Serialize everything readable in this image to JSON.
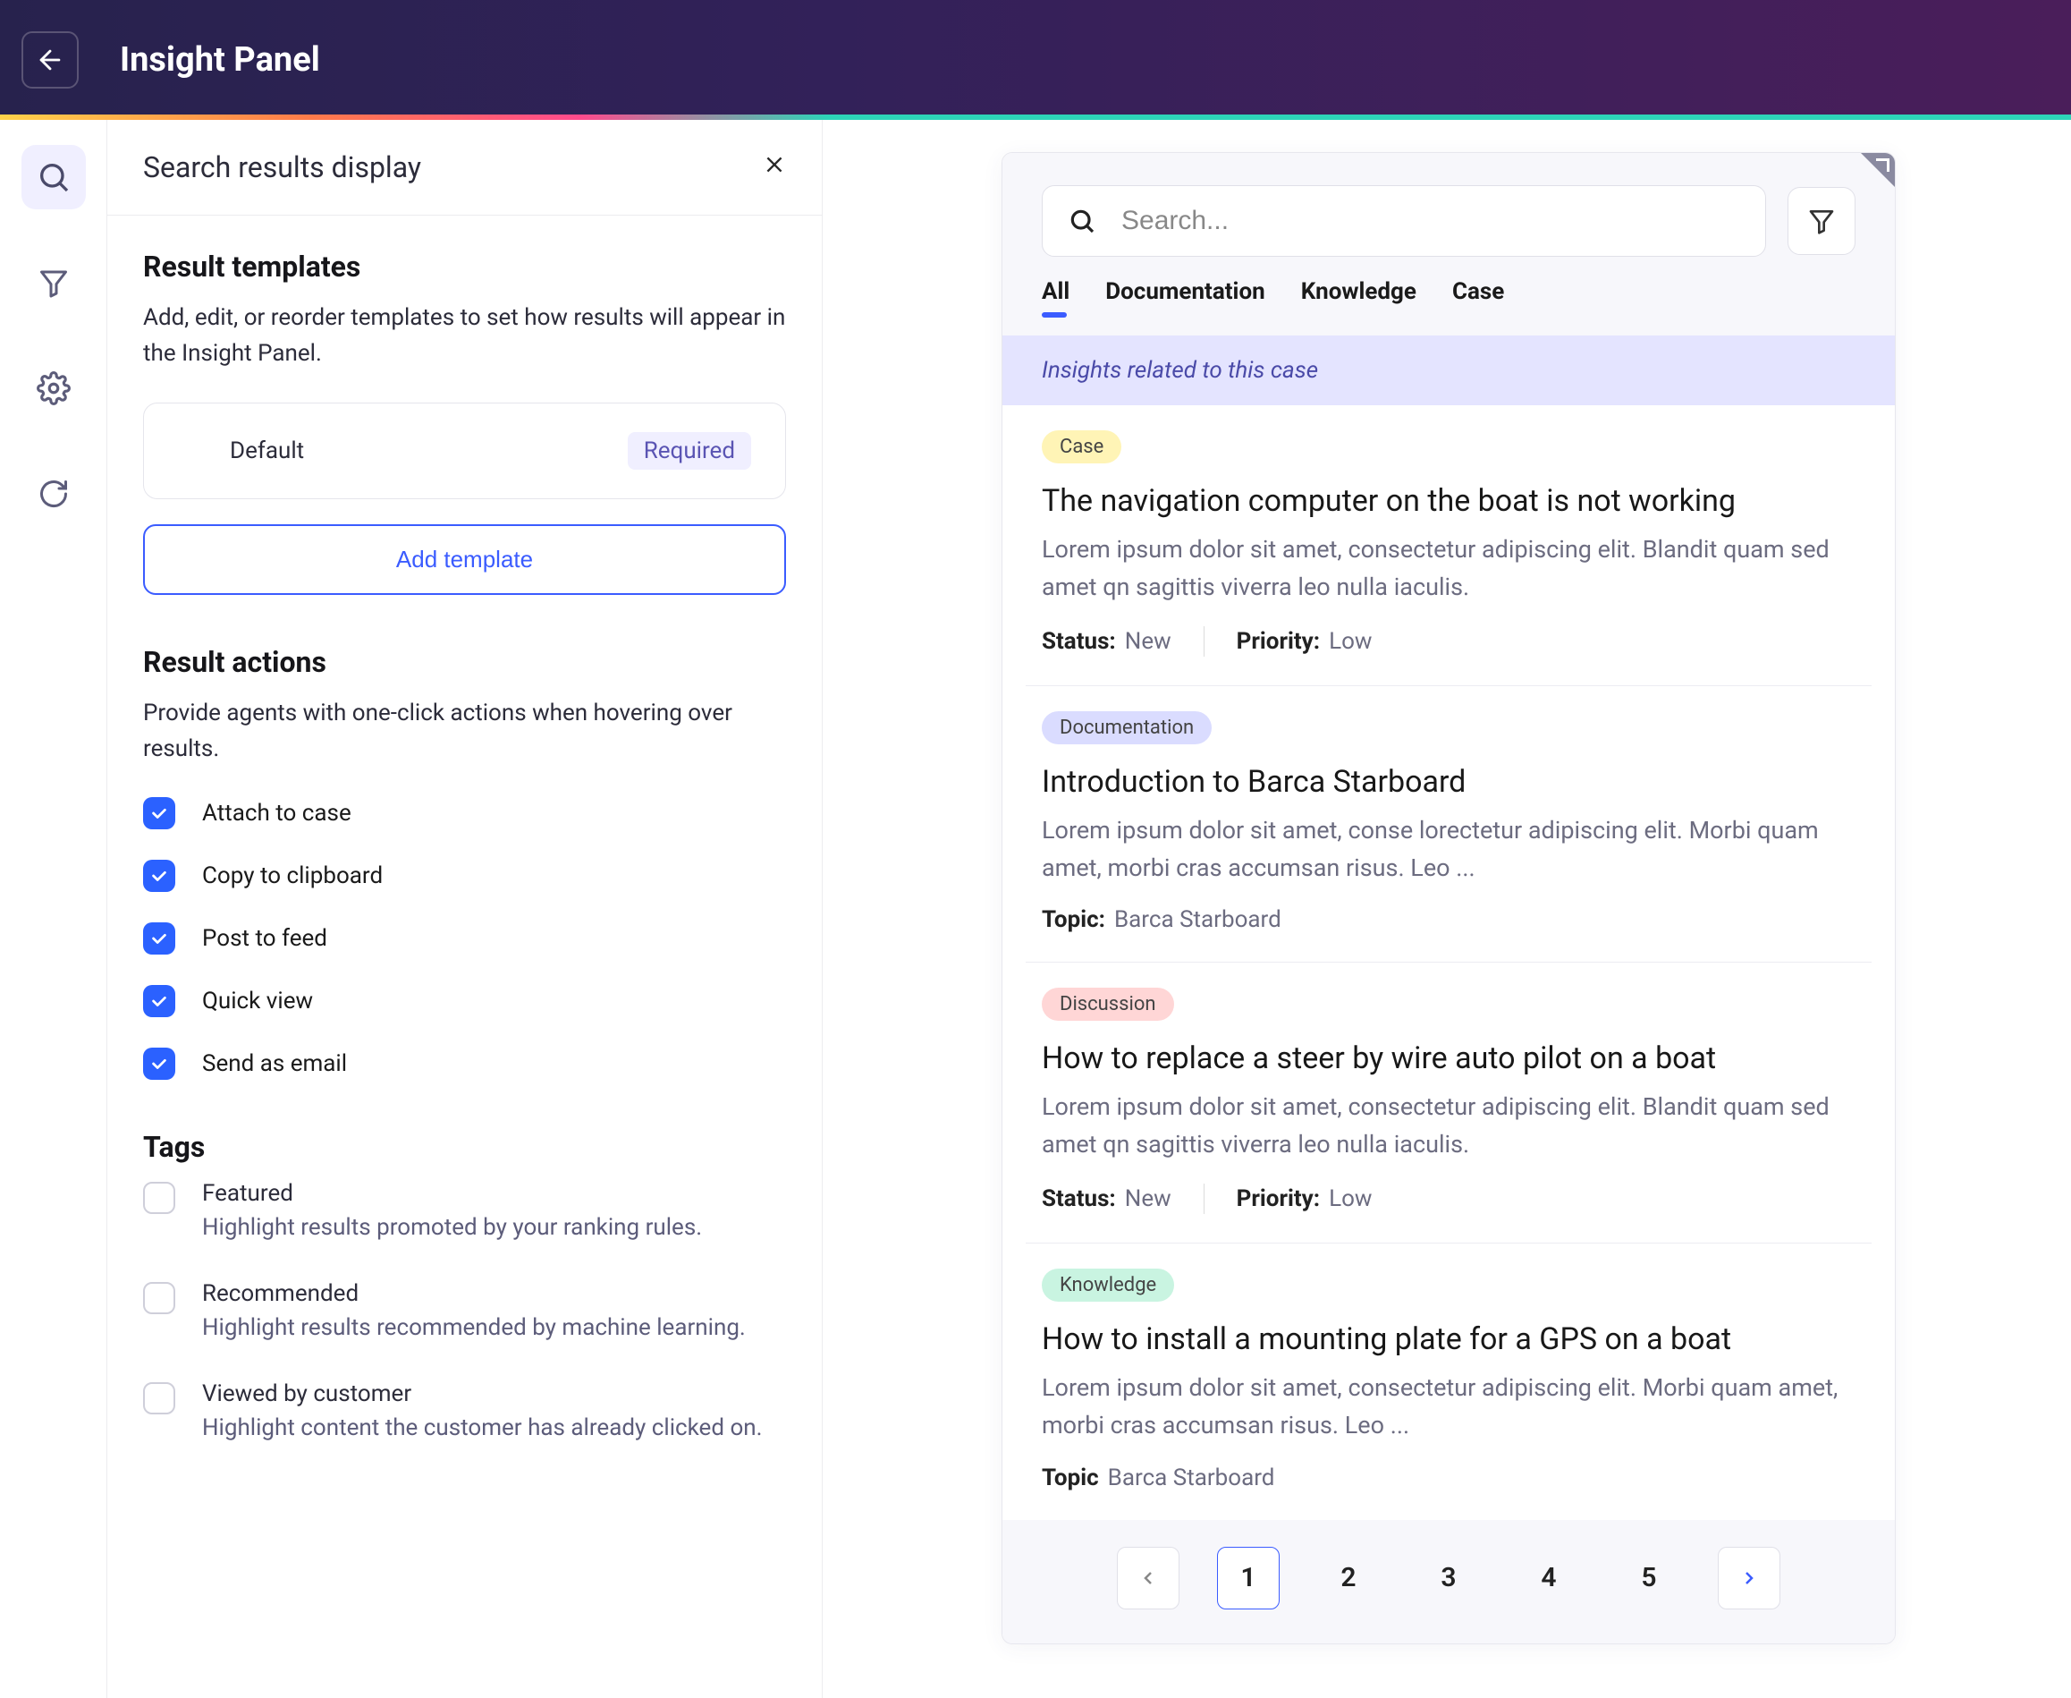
{
  "header": {
    "title": "Insight Panel"
  },
  "sidebar": {
    "title": "Search results display",
    "templates": {
      "heading": "Result templates",
      "desc": "Add, edit, or reorder templates to set how results will appear in the Insight Panel.",
      "item_name": "Default",
      "item_badge": "Required",
      "add_button": "Add template"
    },
    "actions": {
      "heading": "Result actions",
      "desc": "Provide agents with one-click actions when hovering over results.",
      "items": [
        "Attach to case",
        "Copy to clipboard",
        "Post to feed",
        "Quick view",
        "Send as email"
      ]
    },
    "tags": {
      "heading": "Tags",
      "items": [
        {
          "label": "Featured",
          "desc": "Highlight results promoted by your ranking rules."
        },
        {
          "label": "Recommended",
          "desc": "Highlight results recommended by machine learning."
        },
        {
          "label": "Viewed by customer",
          "desc": "Highlight content the customer has already clicked on."
        }
      ]
    }
  },
  "preview": {
    "search_placeholder": "Search...",
    "tabs": [
      "All",
      "Documentation",
      "Knowledge",
      "Case"
    ],
    "banner": "Insights related to this case",
    "results": [
      {
        "badge": "Case",
        "badge_class": "b-case",
        "title": "The navigation computer on the boat is not working",
        "excerpt": "Lorem ipsum dolor sit amet, consectetur adipiscing elit. Blandit quam sed amet qn sagittis viverra leo nulla iaculis.",
        "meta": [
          {
            "k": "Status:",
            "v": "New"
          },
          {
            "k": "Priority:",
            "v": "Low"
          }
        ]
      },
      {
        "badge": "Documentation",
        "badge_class": "b-doc",
        "title": "Introduction to Barca Starboard",
        "excerpt": "Lorem ipsum dolor sit amet, conse  lorectetur adipiscing elit. Morbi quam amet, morbi cras accumsan risus. Leo ...",
        "meta": [
          {
            "k": "Topic:",
            "v": "Barca Starboard"
          }
        ]
      },
      {
        "badge": "Discussion",
        "badge_class": "b-disc",
        "title": "How to replace a steer by wire auto pilot on a boat",
        "excerpt": "Lorem ipsum dolor sit amet, consectetur adipiscing elit. Blandit quam sed amet qn sagittis viverra leo nulla iaculis.",
        "meta": [
          {
            "k": "Status:",
            "v": "New"
          },
          {
            "k": "Priority:",
            "v": "Low"
          }
        ]
      },
      {
        "badge": "Knowledge",
        "badge_class": "b-know",
        "title": "How to install a mounting plate for a GPS on a boat",
        "excerpt": "Lorem ipsum dolor sit amet, consectetur adipiscing elit. Morbi quam amet, morbi cras accumsan risus. Leo ...",
        "meta": [
          {
            "k": "Topic",
            "v": "Barca Starboard"
          }
        ]
      }
    ],
    "pages": [
      "1",
      "2",
      "3",
      "4",
      "5"
    ]
  }
}
